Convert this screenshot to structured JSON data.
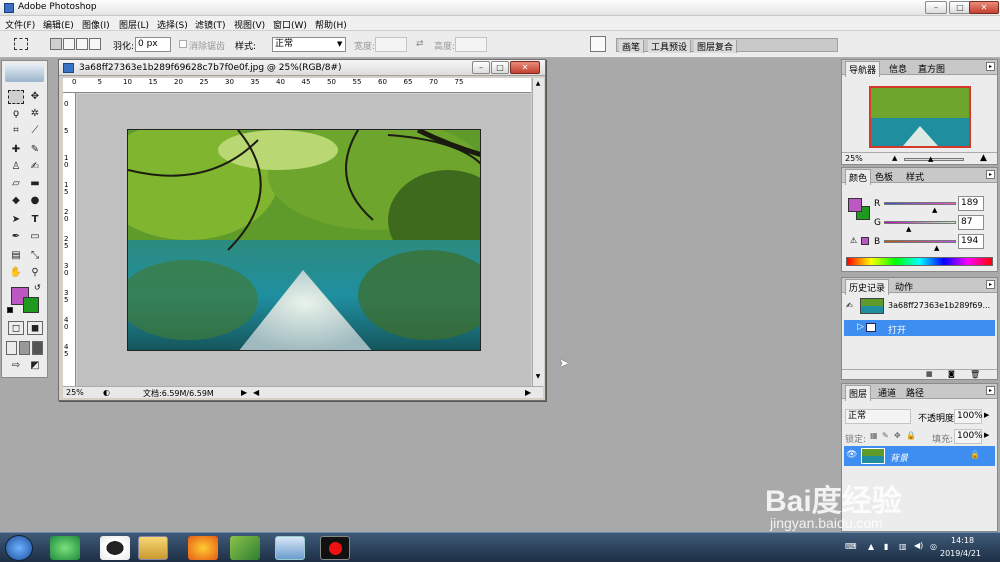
{
  "app": {
    "title": "Adobe Photoshop",
    "min": "–",
    "max": "□",
    "close": "✕"
  },
  "menu": [
    "文件(F)",
    "编辑(E)",
    "图像(I)",
    "图层(L)",
    "选择(S)",
    "滤镜(T)",
    "视图(V)",
    "窗口(W)",
    "帮助(H)"
  ],
  "options": {
    "feather_label": "羽化:",
    "feather_value": "0 px",
    "antialias_label": "消除锯齿",
    "style_label": "样式:",
    "style_value": "正常",
    "width_label": "宽度:",
    "height_label": "高度:",
    "wells": [
      "画笔",
      "工具预设",
      "图层复合"
    ]
  },
  "document": {
    "title": "3a68ff27363e1b289f69628c7b7f0e0f.jpg @ 25%(RGB/8#)",
    "zoom": "25%",
    "doc_size": "文档:6.59M/6.59M",
    "ruler_h": [
      "0",
      "5",
      "10",
      "15",
      "20",
      "25",
      "30",
      "35",
      "40",
      "45",
      "50",
      "55",
      "60",
      "65",
      "70",
      "75"
    ],
    "ruler_v": [
      "0",
      "5",
      "1\n0",
      "1\n5",
      "2\n0",
      "2\n5",
      "3\n0",
      "3\n5",
      "4\n0",
      "4\n5"
    ]
  },
  "navigator": {
    "tabs": [
      "导航器",
      "信息",
      "直方图"
    ],
    "zoom": "25%"
  },
  "color": {
    "tabs": [
      "颜色",
      "色板",
      "样式"
    ],
    "r_label": "R",
    "g_label": "G",
    "b_label": "B",
    "r": "189",
    "g": "87",
    "b": "194",
    "fg": "#bd57c2",
    "bg": "#1f9a1f"
  },
  "history": {
    "tabs": [
      "历史记录",
      "动作"
    ],
    "snapshot": "3a68ff27363e1b289f69...",
    "step": "打开"
  },
  "layers": {
    "tabs": [
      "图层",
      "通道",
      "路径"
    ],
    "blend": "正常",
    "opacity_label": "不透明度:",
    "opacity": "100%",
    "lock_label": "锁定:",
    "fill_label": "填充:",
    "fill": "100%",
    "layer_name": "背景"
  },
  "taskbar": {
    "time": "14:18",
    "date": "2019/4/21"
  },
  "watermark": {
    "brand": "Bai度经验",
    "url": "jingyan.baidu.com"
  }
}
